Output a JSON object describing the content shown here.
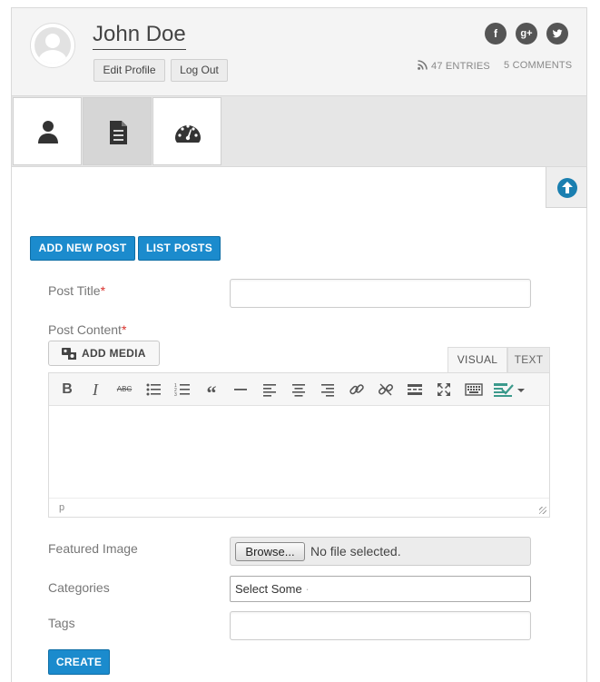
{
  "profile": {
    "name": "John Doe",
    "edit_profile_label": "Edit Profile",
    "logout_label": "Log Out",
    "social": {
      "facebook": "f",
      "googleplus": "g+",
      "twitter": "t"
    },
    "entries_label": "47 ENTRIES",
    "comments_label": "5 COMMENTS"
  },
  "tabs": [
    {
      "name": "profile",
      "icon": "user-icon"
    },
    {
      "name": "posts",
      "icon": "document-icon",
      "active": true
    },
    {
      "name": "dashboard",
      "icon": "dashboard-gauge-icon"
    }
  ],
  "actions": {
    "add_new_post": "ADD NEW POST",
    "list_posts": "LIST POSTS"
  },
  "form": {
    "post_title_label": "Post Title",
    "post_content_label": "Post Content",
    "required_mark": "*",
    "add_media_label": "ADD MEDIA",
    "visual_tab": "VISUAL",
    "text_tab": "TEXT",
    "editor_path": "p",
    "featured_image_label": "Featured Image",
    "browse_label": "Browse...",
    "file_status": "No file selected.",
    "categories_label": "Categories",
    "categories_placeholder": "Select Some",
    "tags_label": "Tags",
    "create_label": "CREATE"
  },
  "toolbar_icons": [
    "bold-icon",
    "italic-icon",
    "strikethrough-icon",
    "bullet-list-icon",
    "numbered-list-icon",
    "blockquote-icon",
    "horizontal-rule-icon",
    "align-left-icon",
    "align-center-icon",
    "align-right-icon",
    "link-icon",
    "unlink-icon",
    "read-more-icon",
    "fullscreen-icon",
    "toolbar-toggle-icon",
    "format-dropdown-icon"
  ],
  "colors": {
    "primary": "#1b8bcd",
    "required": "#d9302b",
    "scroll_top": "#1a7fb0"
  }
}
